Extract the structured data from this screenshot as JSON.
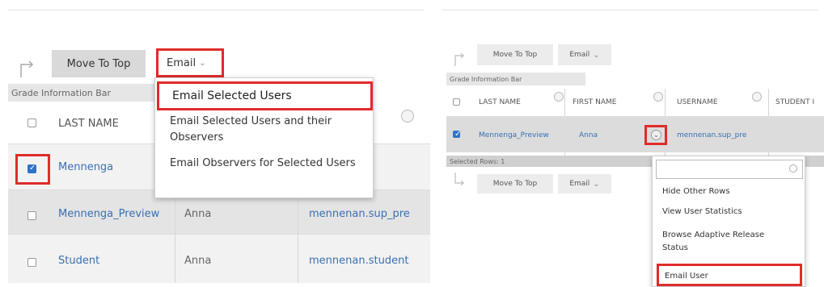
{
  "left": {
    "toolbar": {
      "move_to_top": "Move To Top",
      "email": "Email"
    },
    "grade_info_bar": "Grade Information Bar",
    "header": {
      "last_name": "LAST NAME"
    },
    "email_menu": [
      "Email Selected Users",
      "Email Selected Users and their Observers",
      "Email Observers for Selected Users"
    ],
    "rows": [
      {
        "last": "Mennenga",
        "first": "",
        "username": "",
        "checked": true
      },
      {
        "last": "Mennenga_Preview",
        "first": "Anna",
        "username": "mennenan.sup_pre",
        "checked": false
      },
      {
        "last": "Student",
        "first": "Anna",
        "username": "mennenan.student",
        "checked": false
      }
    ]
  },
  "right": {
    "toolbar": {
      "move_to_top": "Move To Top",
      "email": "Email"
    },
    "grade_info_bar": "Grade Information Bar",
    "headers": {
      "last_name": "LAST NAME",
      "first_name": "FIRST NAME",
      "username": "USERNAME",
      "student": "STUDENT I"
    },
    "row": {
      "last": "Mennenga_Preview",
      "first": "Anna",
      "username": "mennenan.sup_pre",
      "checked": true
    },
    "selected_rows": "Selected Rows: 1",
    "bottom_toolbar": {
      "move_to_top": "Move To Top",
      "email": "Email"
    },
    "context_menu": [
      "Hide Other Rows",
      "View User Statistics",
      "Browse Adaptive Release Status",
      "Email User"
    ]
  },
  "colors": {
    "highlight": "#e02b2b",
    "link": "#3a6fb1",
    "checkbox": "#2f73c9"
  }
}
